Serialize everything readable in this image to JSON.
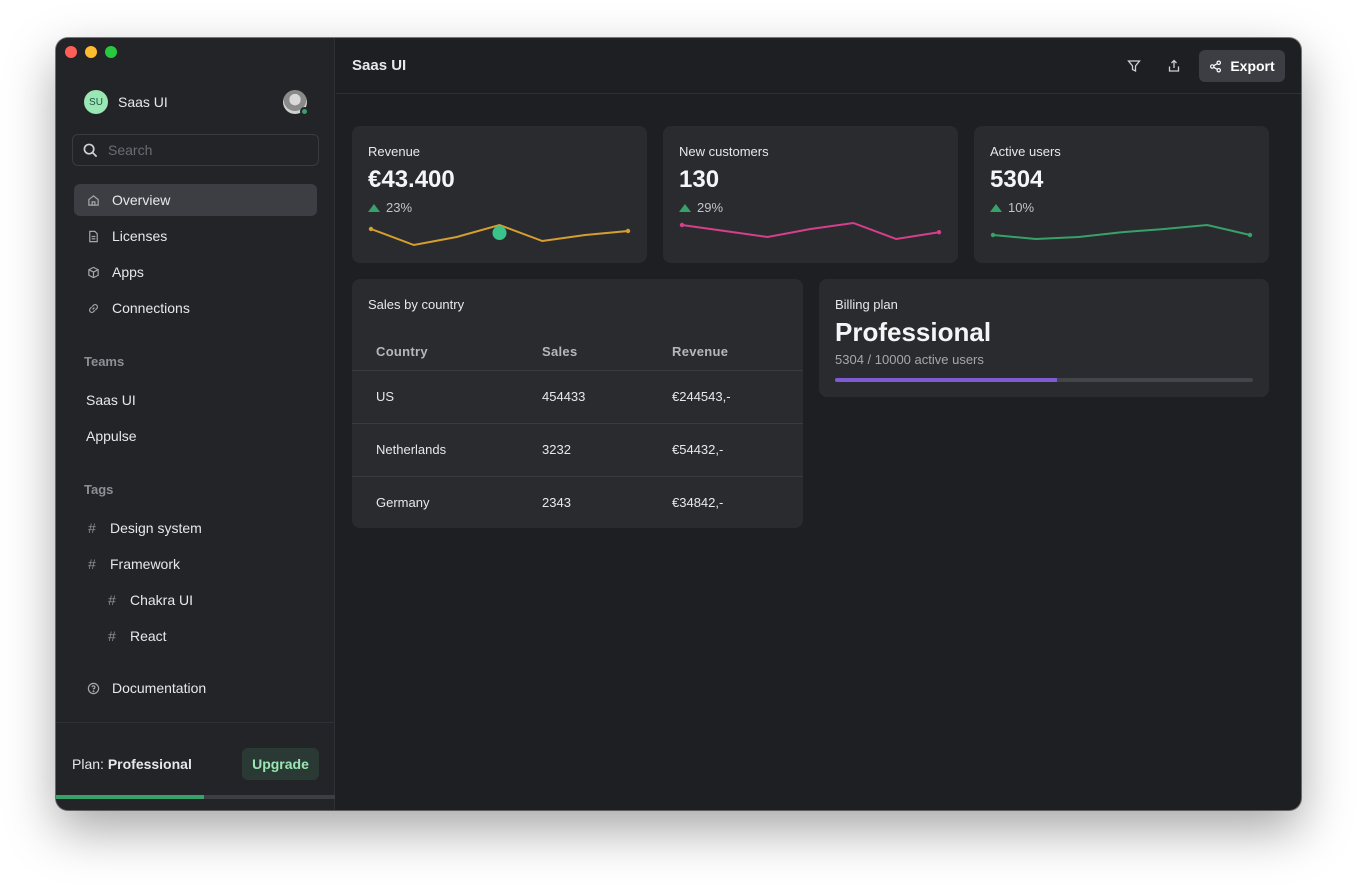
{
  "app": {
    "title": "Saas UI",
    "brand_initials": "SU",
    "brand_name": "Saas UI"
  },
  "search": {
    "placeholder": "Search"
  },
  "nav": [
    {
      "label": "Overview",
      "icon": "home-icon",
      "active": true
    },
    {
      "label": "Licenses",
      "icon": "document-icon"
    },
    {
      "label": "Apps",
      "icon": "cube-icon"
    },
    {
      "label": "Connections",
      "icon": "link-icon"
    }
  ],
  "teams": {
    "heading": "Teams",
    "items": [
      "Saas UI",
      "Appulse"
    ]
  },
  "tags": {
    "heading": "Tags",
    "items": [
      {
        "label": "Design system"
      },
      {
        "label": "Framework"
      },
      {
        "label": "Chakra UI"
      },
      {
        "label": "React"
      }
    ]
  },
  "documentation": {
    "label": "Documentation",
    "icon": "help-circle-icon"
  },
  "footer": {
    "plan_prefix": "Plan:",
    "plan_name": "Professional",
    "upgrade_label": "Upgrade",
    "progress": 0.53
  },
  "toolbar": {
    "title": "Saas UI",
    "export_label": "Export"
  },
  "stats": [
    {
      "label": "Revenue",
      "value": "€43.400",
      "change": "23%",
      "color": "#d69e2e",
      "points": [
        8,
        4,
        6,
        9,
        5,
        6.5,
        7.5
      ],
      "highlight": 3
    },
    {
      "label": "New customers",
      "value": "130",
      "change": "29%",
      "color": "#d53f8c",
      "points": [
        9,
        7.5,
        6,
        8,
        9.5,
        5.5,
        7.2
      ],
      "highlight": -1
    },
    {
      "label": "Active users",
      "value": "5304",
      "change": "10%",
      "color": "#38a169",
      "points": [
        6.5,
        5.5,
        6,
        7.2,
        8,
        9,
        6.5
      ],
      "highlight": -1
    }
  ],
  "sales": {
    "title": "Sales by country",
    "columns": [
      "Country",
      "Sales",
      "Revenue"
    ],
    "rows": [
      [
        "US",
        "454433",
        "€244543,-"
      ],
      [
        "Netherlands",
        "3232",
        "€54432,-"
      ],
      [
        "Germany",
        "2343",
        "€34842,-"
      ]
    ]
  },
  "billing": {
    "title": "Billing plan",
    "plan": "Professional",
    "usage": "5304 / 10000 active users",
    "fraction": 0.5304
  }
}
